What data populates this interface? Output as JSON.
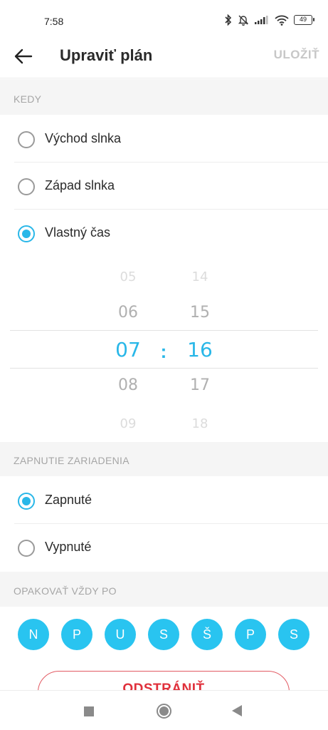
{
  "status_bar": {
    "time": "7:58",
    "battery": "49"
  },
  "app_bar": {
    "title": "Upraviť plán",
    "save_label": "ULOŽIŤ"
  },
  "when_section": {
    "header": "KEDY",
    "options": [
      {
        "label": "Východ slnka",
        "checked": false
      },
      {
        "label": "Západ slnka",
        "checked": false
      },
      {
        "label": "Vlastný čas",
        "checked": true
      }
    ]
  },
  "time_picker": {
    "hours": [
      "05",
      "06",
      "07",
      "08",
      "09"
    ],
    "minutes": [
      "14",
      "15",
      "16",
      "17",
      "18"
    ],
    "selected_hour": "07",
    "selected_minute": "16",
    "separator": ":"
  },
  "power_section": {
    "header": "ZAPNUTIE ZARIADENIA",
    "options": [
      {
        "label": "Zapnuté",
        "checked": true
      },
      {
        "label": "Vypnuté",
        "checked": false
      }
    ]
  },
  "repeat_section": {
    "header": "OPAKOVAŤ VŽDY PO",
    "days": [
      "N",
      "P",
      "U",
      "S",
      "Š",
      "P",
      "S"
    ]
  },
  "delete_label": "ODSTRÁNIŤ",
  "colors": {
    "accent": "#29b7e8",
    "chip": "#29c4f0",
    "danger": "#e0303b"
  }
}
